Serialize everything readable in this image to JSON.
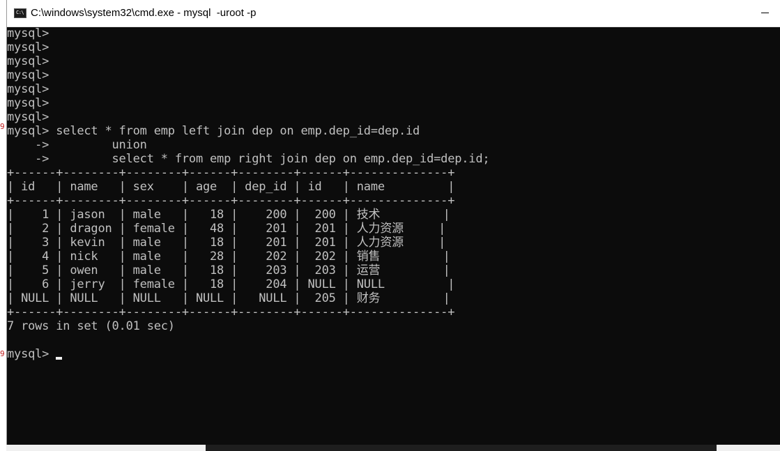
{
  "window": {
    "title": "C:\\windows\\system32\\cmd.exe - mysql  -uroot -p",
    "icon_label": "C:\\",
    "controls": [
      "minimize"
    ]
  },
  "console": {
    "lines": [
      "mysql>",
      "mysql>",
      "mysql>",
      "mysql>",
      "mysql>",
      "mysql>",
      "mysql>",
      "mysql> select * from emp left join dep on emp.dep_id=dep.id",
      "    ->         union",
      "    ->         select * from emp right join dep on emp.dep_id=dep.id;",
      "+------+--------+--------+------+--------+------+--------------+",
      "| id   | name   | sex    | age  | dep_id | id   | name         |",
      "+------+--------+--------+------+--------+------+--------------+",
      "|    1 | jason  | male   |   18 |    200 |  200 | 技术         |",
      "|    2 | dragon | female |   48 |    201 |  201 | 人力资源     |",
      "|    3 | kevin  | male   |   18 |    201 |  201 | 人力资源     |",
      "|    4 | nick   | male   |   28 |    202 |  202 | 销售         |",
      "|    5 | owen   | male   |   18 |    203 |  203 | 运营         |",
      "|    6 | jerry  | female |   18 |    204 | NULL | NULL         |",
      "| NULL | NULL   | NULL   | NULL |   NULL |  205 | 财务         |",
      "+------+--------+--------+------+--------+------+--------------+",
      "7 rows in set (0.01 sec)",
      ""
    ],
    "prompt": "mysql> "
  },
  "side_marks": [
    "9",
    "9"
  ],
  "colors": {
    "console_bg": "#0c0c0c",
    "console_text": "#c0c0c0",
    "titlebar_bg": "#ffffff"
  }
}
